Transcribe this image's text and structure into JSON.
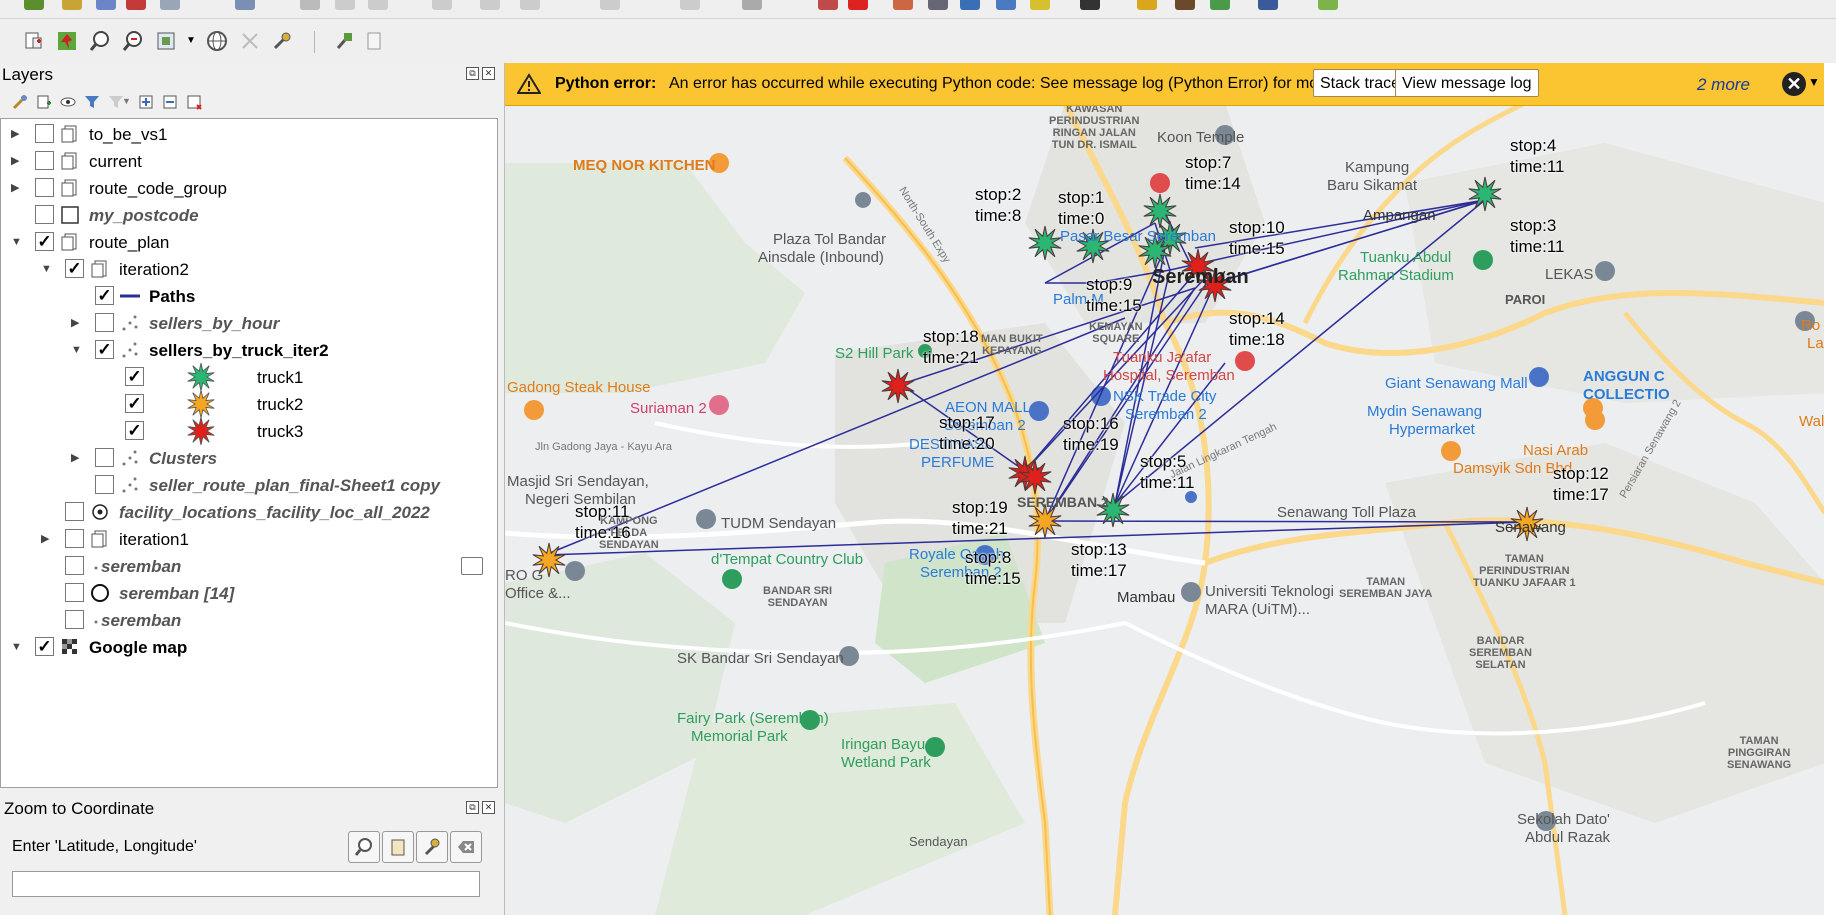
{
  "layers_panel": {
    "title": "Layers",
    "tree": [
      {
        "name": "to_be_vs1",
        "checked": false
      },
      {
        "name": "current",
        "checked": false
      },
      {
        "name": "route_code_group",
        "checked": false
      },
      {
        "name": "my_postcode",
        "checked": false
      },
      {
        "name": "route_plan",
        "checked": true
      },
      {
        "name": "iteration2",
        "checked": true
      },
      {
        "name": "Paths",
        "checked": true
      },
      {
        "name": "sellers_by_hour",
        "checked": false
      },
      {
        "name": "sellers_by_truck_iter2",
        "checked": true
      },
      {
        "name": "truck1",
        "checked": true
      },
      {
        "name": "truck2",
        "checked": true
      },
      {
        "name": "truck3",
        "checked": true
      },
      {
        "name": "Clusters",
        "checked": false
      },
      {
        "name": "seller_route_plan_final-Sheet1 copy",
        "checked": false
      },
      {
        "name": "facility_locations_facility_loc_all_2022",
        "checked": false
      },
      {
        "name": "iteration1",
        "checked": false
      },
      {
        "name": "seremban",
        "checked": false
      },
      {
        "name": "seremban [14]",
        "checked": false
      },
      {
        "name": "seremban",
        "checked": false
      },
      {
        "name": "Google map",
        "checked": true
      }
    ]
  },
  "zoom_panel": {
    "title": "Zoom to Coordinate",
    "label": "Enter 'Latitude, Longitude'",
    "input_value": ""
  },
  "error_bar": {
    "title": "Python error:",
    "message": "An error has occurred while executing Python code: See message log (Python Error) for more details.",
    "stack_trace": "Stack trace",
    "view_log": "View message log",
    "more": "2 more"
  },
  "map": {
    "stops": [
      {
        "stop": "stop:2",
        "time": "time:8"
      },
      {
        "stop": "stop:1",
        "time": "time:0"
      },
      {
        "stop": "stop:7",
        "time": "time:14"
      },
      {
        "stop": "stop:10",
        "time": "time:15"
      },
      {
        "stop": "stop:4",
        "time": "time:11"
      },
      {
        "stop": "stop:3",
        "time": "time:11"
      },
      {
        "stop": "stop:9",
        "time": "time:15"
      },
      {
        "stop": "stop:14",
        "time": "time:18"
      },
      {
        "stop": "stop:18",
        "time": "time:21"
      },
      {
        "stop": "stop:17",
        "time": "time:20"
      },
      {
        "stop": "stop:16",
        "time": "time:19"
      },
      {
        "stop": "stop:5",
        "time": "time:11"
      },
      {
        "stop": "stop:12",
        "time": "time:17"
      },
      {
        "stop": "stop:11",
        "time": "time:16"
      },
      {
        "stop": "stop:19",
        "time": "time:21"
      },
      {
        "stop": "stop:8",
        "time": "time:15"
      },
      {
        "stop": "stop:13",
        "time": "time:17"
      }
    ],
    "places": {
      "meq": "MEQ NOR KITCHEN",
      "plaza_tol": "Plaza Tol Bandar",
      "plaza_tol2": "Ainsdale (Inbound)",
      "koon": "Koon Temple",
      "kampung": "Kampung",
      "kampung2": "Baru Sikamat",
      "ampangan": "Ampangan",
      "pasar": "Pasar Besar Seremban",
      "seremban": "Seremban",
      "tuanku_abdul": "Tuanku Abdul",
      "tuanku_abdul2": "Rahman Stadium",
      "lekas": "LEKAS",
      "paroi": "PAROI",
      "palm": "Palm M",
      "s2hill": "S2 Hill Park",
      "gadong": "Gadong Steak House",
      "suriaman": "Suriaman 2",
      "aeon": "AEON MALL",
      "aeon2": "Seremban 2",
      "destinasi": "DESTINASI",
      "perfume": "PERFUME",
      "tuanku_jaafar": "Tuanku Ja'afar",
      "tuanku_jaafar2": "Hospital, Seremban",
      "nsk": "NSK Trade City",
      "nsk2": "Seremban 2",
      "giant": "Giant Senawang Mall",
      "mydin": "Mydin Senawang",
      "mydin2": "Hypermarket",
      "anggun": "ANGGUN C",
      "anggun2": "COLLECTIO",
      "nasi": "Nasi Arab",
      "nasi2": "Damsyik Sdn Bhd",
      "masjid": "Masjid Sri Sendayan,",
      "masjid2": "Negeri Sembilan",
      "tudm": "TUDM Sendayan",
      "tempat": "d'Tempat Country Club",
      "royale": "Royale Qaseh",
      "royale2": "Seremban 2",
      "seremban2_area": "SEREMBAN 2",
      "senawang_toll": "Senawang Toll Plaza",
      "senawang": "Senawang",
      "mambau": "Mambau",
      "uitm": "Universiti Teknologi",
      "uitm2": "MARA (UiTM)...",
      "sk_bandar": "SK Bandar Sri Sendayan",
      "fairy": "Fairy Park (Seremban)",
      "fairy2": "Memorial Park",
      "iringan": "Iringan Bayu",
      "iringan2": "Wetland Park",
      "sekolah": "Sekolah Dato'",
      "sekolah2": "Abdul Razak",
      "ro_office": "RO G",
      "ro_office2": "Office &...",
      "ro": "Ro",
      "la": "La",
      "wal": "Wal",
      "kawasan": "KAWASAN",
      "kawasan2": "PERINDUSTRIAN",
      "kawasan3": "RINGAN JALAN",
      "kawasan4": "TUN DR. ISMAIL",
      "man_bukit": "MAN BUKIT",
      "man_bukit2": "KEPAYANG",
      "kemayan": "KEMAYAN",
      "kemayan2": "SQUARE",
      "kampong": "KAMPONG",
      "kampong2": "FELDA",
      "kampong3": "SENDAYAN",
      "bandar_sri": "BANDAR SRI",
      "bandar_sri2": "SENDAYAN",
      "taman_peri": "TAMAN",
      "taman_peri2": "PERINDUSTRIAN",
      "taman_peri3": "TUANKU JAFAAR 1",
      "taman_seremban": "TAMAN",
      "taman_seremban2": "SEREMBAN JAYA",
      "bandar_seremban": "BANDAR",
      "bandar_seremban2": "SEREMBAN",
      "bandar_seremban3": "SELATAN",
      "taman_pinggiran": "TAMAN",
      "taman_pinggiran2": "PINGGIRAN",
      "taman_pinggiran3": "SENAWANG",
      "jln_gadong": "Jln Gadong Jaya - Kayu Ara",
      "jalan_lingkaran": "Jalan Lingkaran Tengah",
      "north_south": "North-South Expy",
      "persiaran": "Persiaran Senawang 2",
      "sendayan_bottom": "Sendayan"
    },
    "colors": {
      "route": "#2d2d9a",
      "truck1": "#2bb673",
      "truck2": "#f5a623",
      "truck3": "#e0201b",
      "error_bar": "#fbc531"
    }
  }
}
